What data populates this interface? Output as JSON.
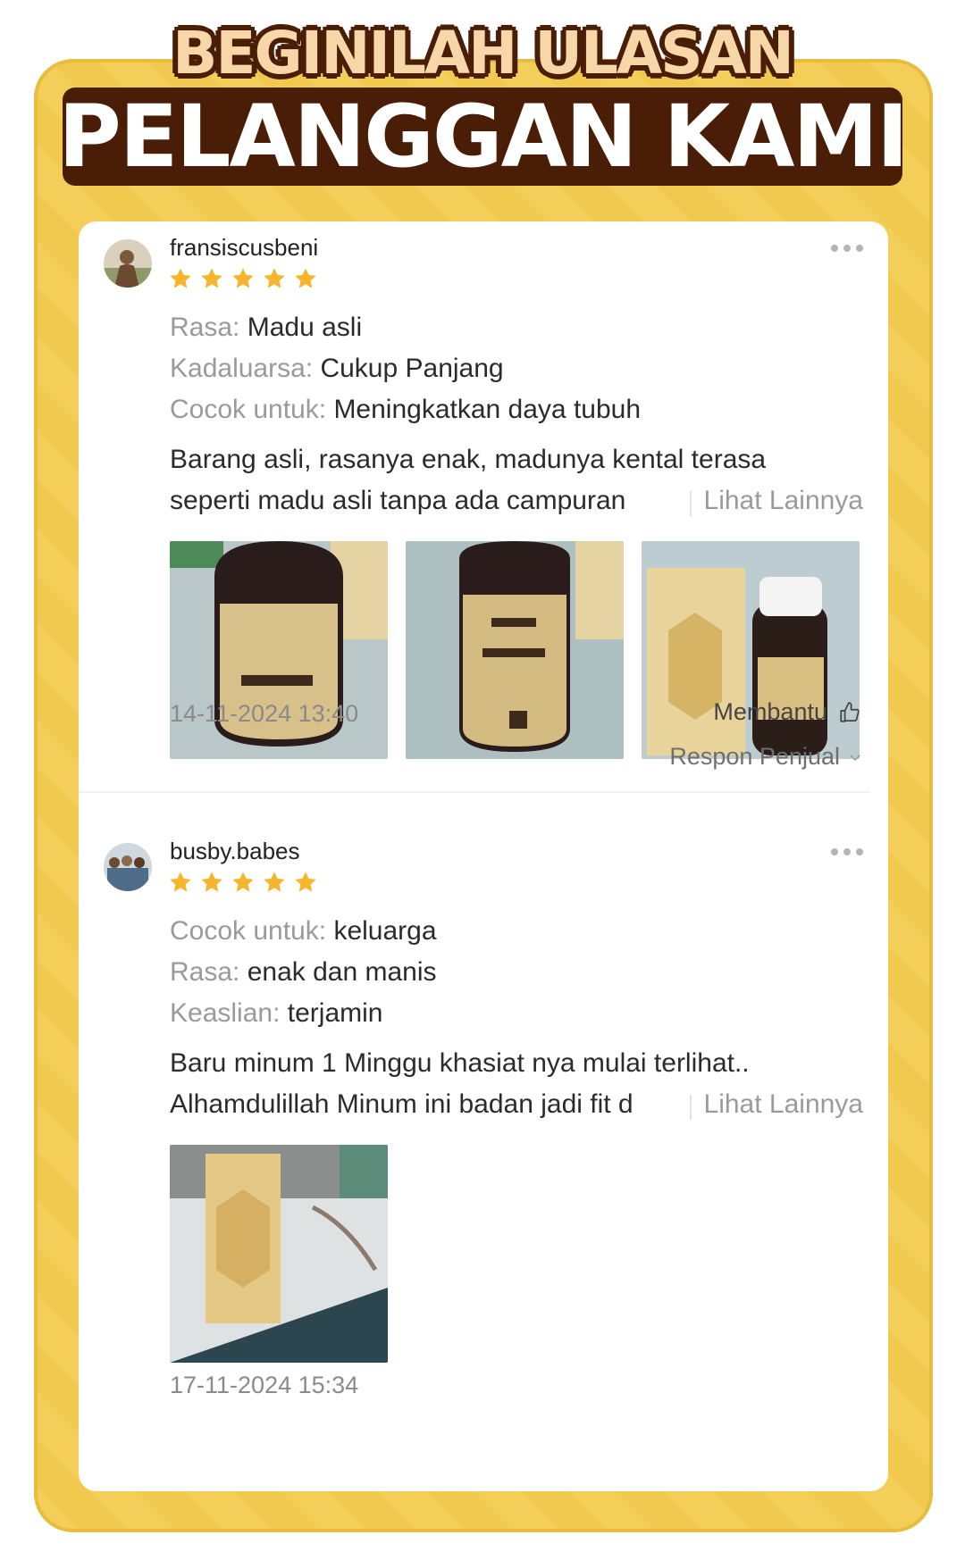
{
  "banner": {
    "line1": "BEGINILAH ULASAN",
    "line2": "PELANGGAN KAMI"
  },
  "reviews": [
    {
      "username": "fransiscusbeni",
      "rating": 5,
      "attributes": [
        {
          "key": "Rasa:",
          "value": "Madu asli"
        },
        {
          "key": "Kadaluarsa:",
          "value": "Cukup Panjang"
        },
        {
          "key": "Cocok untuk:",
          "value": "Meningkatkan daya tubuh"
        }
      ],
      "text_line1": "Barang asli, rasanya enak, madunya kental terasa",
      "text_line2": "seperti madu asli tanpa ada campuran",
      "see_more": "Lihat Lainnya",
      "photo_count": 3,
      "date": "14-11-2024 13:40",
      "helpful_label": "Membantu",
      "seller_response_label": "Respon Penjual"
    },
    {
      "username": "busby.babes",
      "rating": 5,
      "attributes": [
        {
          "key": "Cocok untuk:",
          "value": "keluarga"
        },
        {
          "key": "Rasa:",
          "value": "enak dan manis"
        },
        {
          "key": "Keaslian:",
          "value": "terjamin"
        }
      ],
      "text_line1": "Baru minum 1 Minggu khasiat nya mulai terlihat..",
      "text_line2": "Alhamdulillah Minum ini badan jadi fit d",
      "see_more": "Lihat Lainnya",
      "photo_count": 1,
      "date": "17-11-2024 15:34"
    }
  ],
  "colors": {
    "frame": "#f3cf5a",
    "banner_dark": "#4a1e06",
    "banner_light": "#f7d7a8",
    "star": "#f6b52c"
  }
}
